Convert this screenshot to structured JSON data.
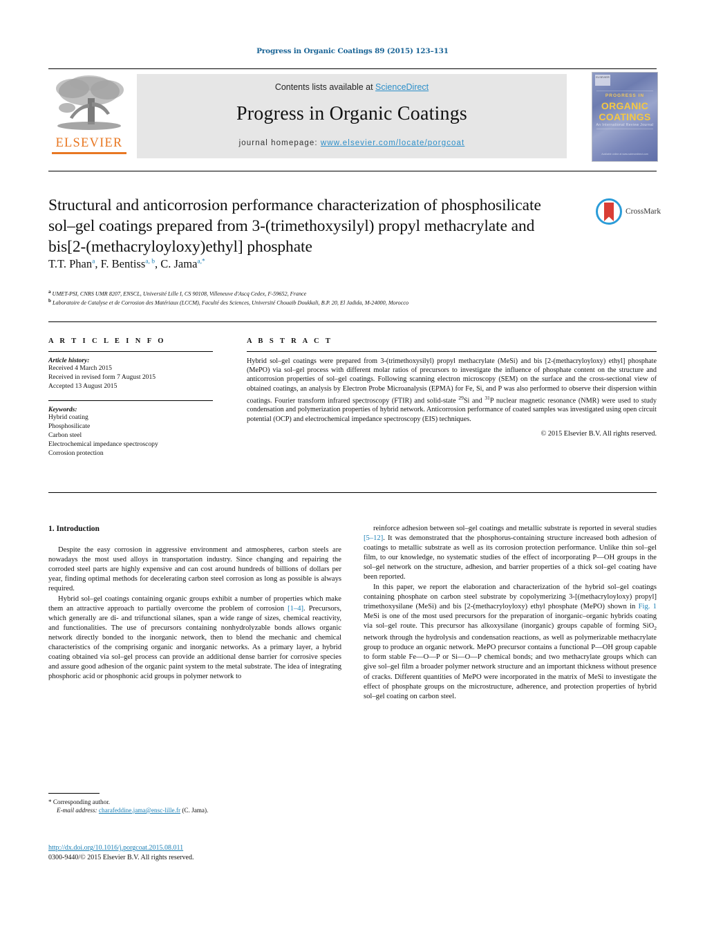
{
  "running_head": "Progress in Organic Coatings 89 (2015) 123–131",
  "masthead": {
    "publisher_logo_label": "ELSEVIER",
    "contents_prefix": "Contents lists available at ",
    "contents_link": "ScienceDirect",
    "journal_title": "Progress in Organic Coatings",
    "homepage_prefix": "journal homepage: ",
    "homepage_url": "www.elsevier.com/locate/porgcoat",
    "cover": {
      "publisher_mark": "ELSEVIER",
      "line_top": "PROGRESS IN",
      "line_main_1": "ORGANIC",
      "line_main_2": "COATINGS",
      "subtitle": "An International Review Journal",
      "footer": "Available online at www.sciencedirect.com"
    }
  },
  "article": {
    "title": "Structural and anticorrosion performance characterization of phosphosilicate sol–gel coatings prepared from 3-(trimethoxysilyl) propyl methacrylate and bis[2-(methacryloyloxy)ethyl] phosphate",
    "crossmark_label": "CrossMark",
    "authors_html": "T.T. Phan<sup>a</sup>, F. Bentiss<sup>a, b</sup>, C. Jama<sup>a,*</sup>",
    "affiliations": [
      {
        "marker": "a",
        "text": "UMET-PSI, CNRS UMR 8207, ENSCL, Université Lille I, CS 90108, Villeneuve d'Ascq Cedex, F-59652, France"
      },
      {
        "marker": "b",
        "text": "Laboratoire de Catalyse et de Corrosion des Matériaux (LCCM), Faculté des Sciences, Université Chouaib Doukkali, B.P. 20, El Jadida, M-24000, Morocco"
      }
    ]
  },
  "article_info": {
    "heading": "A R T I C L E   I N F O",
    "history_label": "Article history:",
    "history": [
      "Received 4 March 2015",
      "Received in revised form 7 August 2015",
      "Accepted 13 August 2015"
    ],
    "keywords_label": "Keywords:",
    "keywords": [
      "Hybrid coating",
      "Phosphosilicate",
      "Carbon steel",
      "Electrochemical impedance spectroscopy",
      "Corrosion protection"
    ]
  },
  "abstract": {
    "heading": "A B S T R A C T",
    "text": "Hybrid sol–gel coatings were prepared from 3-(trimethoxysilyl) propyl methacrylate (MeSi) and bis [2-(methacryloyloxy) ethyl] phosphate (MePO) via sol–gel process with different molar ratios of precursors to investigate the influence of phosphate content on the structure and anticorrosion properties of sol–gel coatings. Following scanning electron microscopy (SEM) on the surface and the cross-sectional view of obtained coatings, an analysis by Electron Probe Microanalysis (EPMA) for Fe, Si, and P was also performed to observe their dispersion within coatings. Fourier transform infrared spectroscopy (FTIR) and solid-state 29Si and 31P nuclear magnetic resonance (NMR) were used to study condensation and polymerization properties of hybrid network. Anticorrosion performance of coated samples was investigated using open circuit potential (OCP) and electrochemical impedance spectroscopy (EIS) techniques.",
    "copyright": "© 2015 Elsevier B.V. All rights reserved."
  },
  "introduction": {
    "heading": "1. Introduction",
    "left_paragraphs": [
      "Despite the easy corrosion in aggressive environment and atmospheres, carbon steels are nowadays the most used alloys in transportation industry. Since changing and repairing the corroded steel parts are highly expensive and can cost around hundreds of billions of dollars per year, finding optimal methods for decelerating carbon steel corrosion as long as possible is always required.",
      "Hybrid sol–gel coatings containing organic groups exhibit a number of properties which make them an attractive approach to partially overcome the problem of corrosion [1–4]. Precursors, which generally are di- and trifunctional silanes, span a wide range of sizes, chemical reactivity, and functionalities. The use of precursors containing nonhydrolyzable bonds allows organic network directly bonded to the inorganic network, then to blend the mechanic and chemical characteristics of the comprising organic and inorganic networks. As a primary layer, a hybrid coating obtained via sol–gel process can provide an additional dense barrier for corrosive species and assure good adhesion of the organic paint system to the metal substrate. The idea of integrating phosphoric acid or phosphonic acid groups in polymer network to"
    ],
    "right_paragraphs": [
      "reinforce adhesion between sol–gel coatings and metallic substrate is reported in several studies [5–12]. It was demonstrated that the phosphorus-containing structure increased both adhesion of coatings to metallic substrate as well as its corrosion protection performance. Unlike thin sol–gel film, to our knowledge, no systematic studies of the effect of incorporating P—OH groups in the sol–gel network on the structure, adhesion, and barrier properties of a thick sol–gel coating have been reported.",
      "In this paper, we report the elaboration and characterization of the hybrid sol–gel coatings containing phosphate on carbon steel substrate by copolymerizing 3-[(methacryloyloxy) propyl] trimethoxysilane (MeSi) and bis [2-(methacryloyloxy) ethyl phosphate (MePO) shown in Fig. 1 MeSi is one of the most used precursors for the preparation of inorganic–organic hybrids coating via sol–gel route. This precursor has alkoxysilane (inorganic) groups capable of forming SiO2 network through the hydrolysis and condensation reactions, as well as polymerizable methacrylate group to produce an organic network. MePO precursor contains a functional P—OH group capable to form stable Fe—O—P or Si—O—P chemical bonds; and two methacrylate groups which can give sol–gel film a broader polymer network structure and an important thickness without presence of cracks. Different quantities of MePO were incorporated in the matrix of MeSi to investigate the effect of phosphate groups on the microstructure, adherence, and protection properties of hybrid sol–gel coating on carbon steel."
    ],
    "inline_refs": {
      "ref_1_4": "[1–4]",
      "ref_5_12": "[5–12]",
      "fig_1": "Fig. 1"
    }
  },
  "footnote": {
    "corresponding": "* Corresponding author.",
    "email_label": "E-mail address:",
    "email": "charafeddine.jama@ensc-lille.fr",
    "email_owner": "(C. Jama)."
  },
  "footer": {
    "doi": "http://dx.doi.org/10.1016/j.porgcoat.2015.08.011",
    "issn_copyright": "0300-9440/© 2015 Elsevier B.V. All rights reserved."
  },
  "colors": {
    "link": "#1a7fb5",
    "sciencedirect": "#2d8fc9",
    "elsevier_orange": "#E87722",
    "banner_bg": "#e6e6e6"
  }
}
